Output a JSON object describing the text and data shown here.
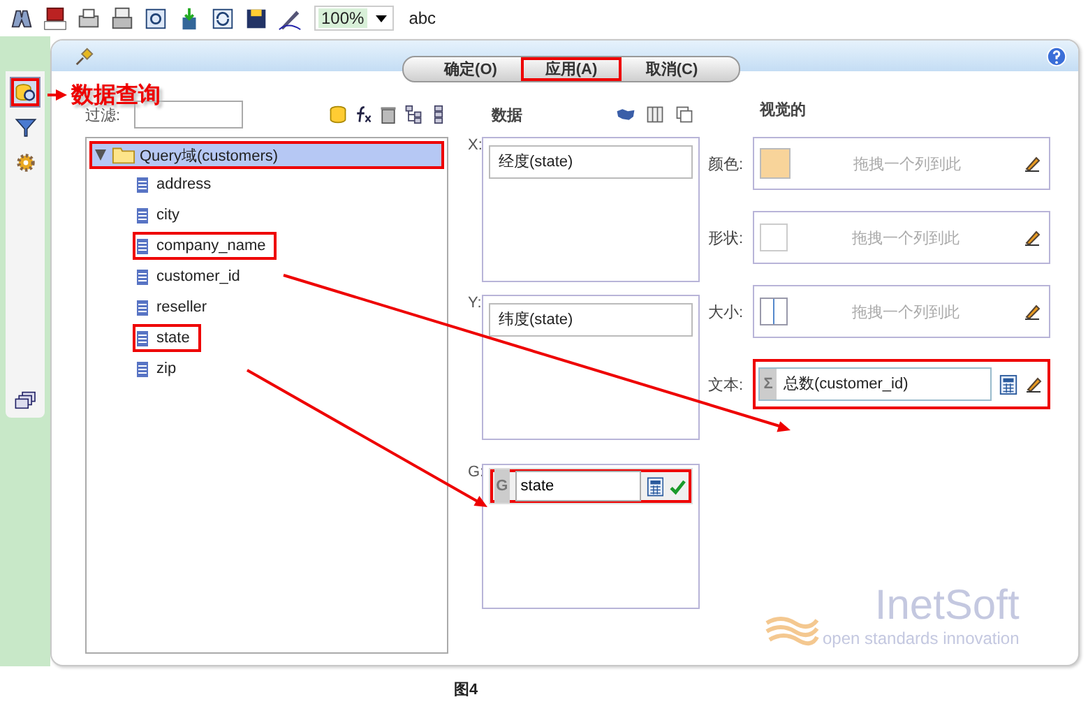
{
  "toolbar": {
    "zoom": "100%",
    "text": "abc"
  },
  "side_tabs": [
    {
      "kind": "query",
      "selected": true,
      "annotated": true
    },
    {
      "kind": "filter",
      "selected": false,
      "annotated": false
    },
    {
      "kind": "gear",
      "selected": false,
      "annotated": false
    }
  ],
  "callout": "数据查询",
  "buttons": [
    {
      "label": "确定(O)",
      "annotated": false
    },
    {
      "label": "应用(A)",
      "annotated": true
    },
    {
      "label": "取消(C)",
      "annotated": false
    }
  ],
  "filter": {
    "label": "过滤:"
  },
  "tree": {
    "label": "Query域(customers)",
    "expanded": true,
    "annotated": true,
    "children": [
      {
        "label": "address",
        "annotated": false
      },
      {
        "label": "city",
        "annotated": false
      },
      {
        "label": "company_name",
        "annotated": true
      },
      {
        "label": "customer_id",
        "annotated": false
      },
      {
        "label": "reseller",
        "annotated": false
      },
      {
        "label": "state",
        "annotated": true
      },
      {
        "label": "zip",
        "annotated": false
      }
    ]
  },
  "data": {
    "title": "数据",
    "shelves": [
      {
        "label": "X:",
        "kind": "field",
        "value": "经度(state)",
        "annotated": false
      },
      {
        "label": "Y:",
        "kind": "field",
        "value": "纬度(state)",
        "annotated": false
      },
      {
        "label": "G:",
        "kind": "editor",
        "badge": "G",
        "value": "state",
        "annotated": true
      }
    ]
  },
  "visual": {
    "title": "视觉的",
    "rows": [
      {
        "label": "颜色:",
        "kind": "color",
        "hint": "拖拽一个列到此",
        "annotated": false
      },
      {
        "label": "形状:",
        "kind": "shape",
        "hint": "拖拽一个列到此",
        "annotated": false
      },
      {
        "label": "大小:",
        "kind": "size",
        "hint": "拖拽一个列到此",
        "annotated": false
      },
      {
        "label": "文本:",
        "kind": "measure",
        "badge": "Σ",
        "value": "总数(customer_id)",
        "annotated": true
      }
    ]
  },
  "logo": {
    "name": "InetSoft",
    "tagline": "open standards innovation"
  },
  "caption": "图4"
}
